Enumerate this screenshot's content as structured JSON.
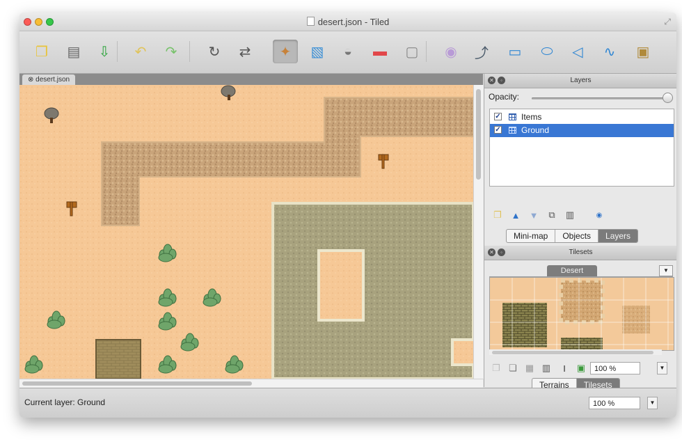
{
  "window": {
    "title": "desert.json - Tiled"
  },
  "toolbar": {
    "tools": [
      {
        "name": "new-map-icon",
        "glyph": "❐",
        "color": "#e8c43a"
      },
      {
        "name": "open-map-icon",
        "glyph": "▤",
        "color": "#666666"
      },
      {
        "name": "save-map-icon",
        "glyph": "⇩",
        "color": "#2aa339"
      },
      {
        "name": "undo-icon",
        "glyph": "↶",
        "color": "#e0c35a"
      },
      {
        "name": "redo-icon",
        "glyph": "↷",
        "color": "#78c26b"
      },
      {
        "name": "rotate-tools-icon",
        "glyph": "↻",
        "color": "#555555"
      },
      {
        "name": "flip-tools-icon",
        "glyph": "⇄",
        "color": "#555555"
      },
      {
        "name": "stamp-brush-icon",
        "glyph": "✦",
        "color": "#c7823a"
      },
      {
        "name": "terrain-brush-icon",
        "glyph": "▧",
        "color": "#3a8fd6"
      },
      {
        "name": "bucket-fill-icon",
        "glyph": "◒",
        "color": "#777777"
      },
      {
        "name": "eraser-icon",
        "glyph": "▬",
        "color": "#e2474a"
      },
      {
        "name": "rect-select-icon",
        "glyph": "▢",
        "color": "#888888"
      },
      {
        "name": "magic-wand-icon",
        "glyph": "◉",
        "color": "#b89ad6"
      },
      {
        "name": "edit-polygons-icon",
        "glyph": "⤴",
        "color": "#4a5a6a"
      },
      {
        "name": "insert-rectangle-icon",
        "glyph": "▭",
        "color": "#2f86d3"
      },
      {
        "name": "insert-ellipse-icon",
        "glyph": "⬭",
        "color": "#2f86d3"
      },
      {
        "name": "insert-polygon-icon",
        "glyph": "◁",
        "color": "#2f86d3"
      },
      {
        "name": "insert-polyline-icon",
        "glyph": "∿",
        "color": "#2f86d3"
      },
      {
        "name": "insert-tile-icon",
        "glyph": "▣",
        "color": "#b08a3a"
      }
    ]
  },
  "document": {
    "tab_label": "desert.json"
  },
  "layers_panel": {
    "title": "Layers",
    "opacity_label": "Opacity:",
    "opacity_value": 1.0,
    "layers": [
      {
        "name": "Items",
        "visible": true,
        "selected": false
      },
      {
        "name": "Ground",
        "visible": true,
        "selected": true
      }
    ],
    "tabs": [
      "Mini-map",
      "Objects",
      "Layers"
    ],
    "active_tab": "Layers"
  },
  "tilesets_panel": {
    "title": "Tilesets",
    "tileset_tab": "Desert",
    "zoom": "100 %",
    "tabs": [
      "Terrains",
      "Tilesets"
    ],
    "active_tab": "Tilesets"
  },
  "status": {
    "current_layer": "Current layer: Ground",
    "zoom": "100 %"
  },
  "colors": {
    "sand": "#f6c896",
    "path": "#c9a47a",
    "stone": "#a8a27e",
    "selection": "#3977d4",
    "cactus": "#5f9a5c"
  }
}
